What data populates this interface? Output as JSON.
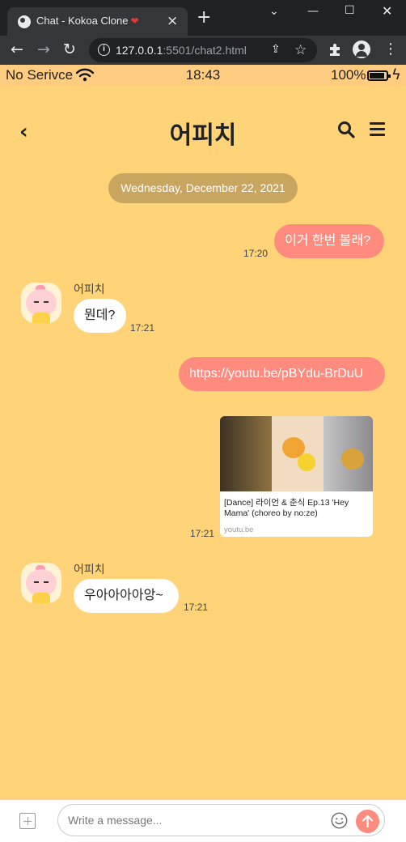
{
  "browser": {
    "tab_title": "Chat - Kokoa Clone",
    "tab_emoji": "❤",
    "url_host": "127.0.0.1",
    "url_rest": ":5501/chat2.html"
  },
  "status_bar": {
    "carrier": "No Serivce",
    "time": "18:43",
    "battery": "100%"
  },
  "header": {
    "title": "어피치"
  },
  "date_divider": "Wednesday, December 22, 2021",
  "messages": [
    {
      "from": "me",
      "text": "이거 한번 볼래?",
      "time": "17:20"
    },
    {
      "from": "them",
      "sender": "어피치",
      "text": "뭔데?",
      "time": "17:21"
    },
    {
      "from": "me",
      "text": "https://youtu.be/pBYdu-BrDuU"
    },
    {
      "from": "me",
      "type": "link-preview",
      "title": "[Dance] 라이언 & 춘식 Ep.13 'Hey Mama' (choreo by no:ze)",
      "host": "youtu.be",
      "time": "17:21"
    },
    {
      "from": "them",
      "sender": "어피치",
      "text": "우아아아아앙~",
      "time": "17:21"
    }
  ],
  "composer": {
    "placeholder": "Write a message..."
  },
  "icons": {
    "wifi": "wifi-icon",
    "battery": "battery-icon",
    "charging": "bolt-icon",
    "back": "chevron-left-icon",
    "search": "search-icon",
    "menu": "hamburger-icon",
    "attach": "plus-square-icon",
    "emoji": "smile-icon",
    "send": "arrow-up-icon"
  },
  "colors": {
    "background": "#ffd479",
    "status_bar": "#ffcc80",
    "my_bubble": "#ff8b7e",
    "date_pill": "#c9a660"
  }
}
